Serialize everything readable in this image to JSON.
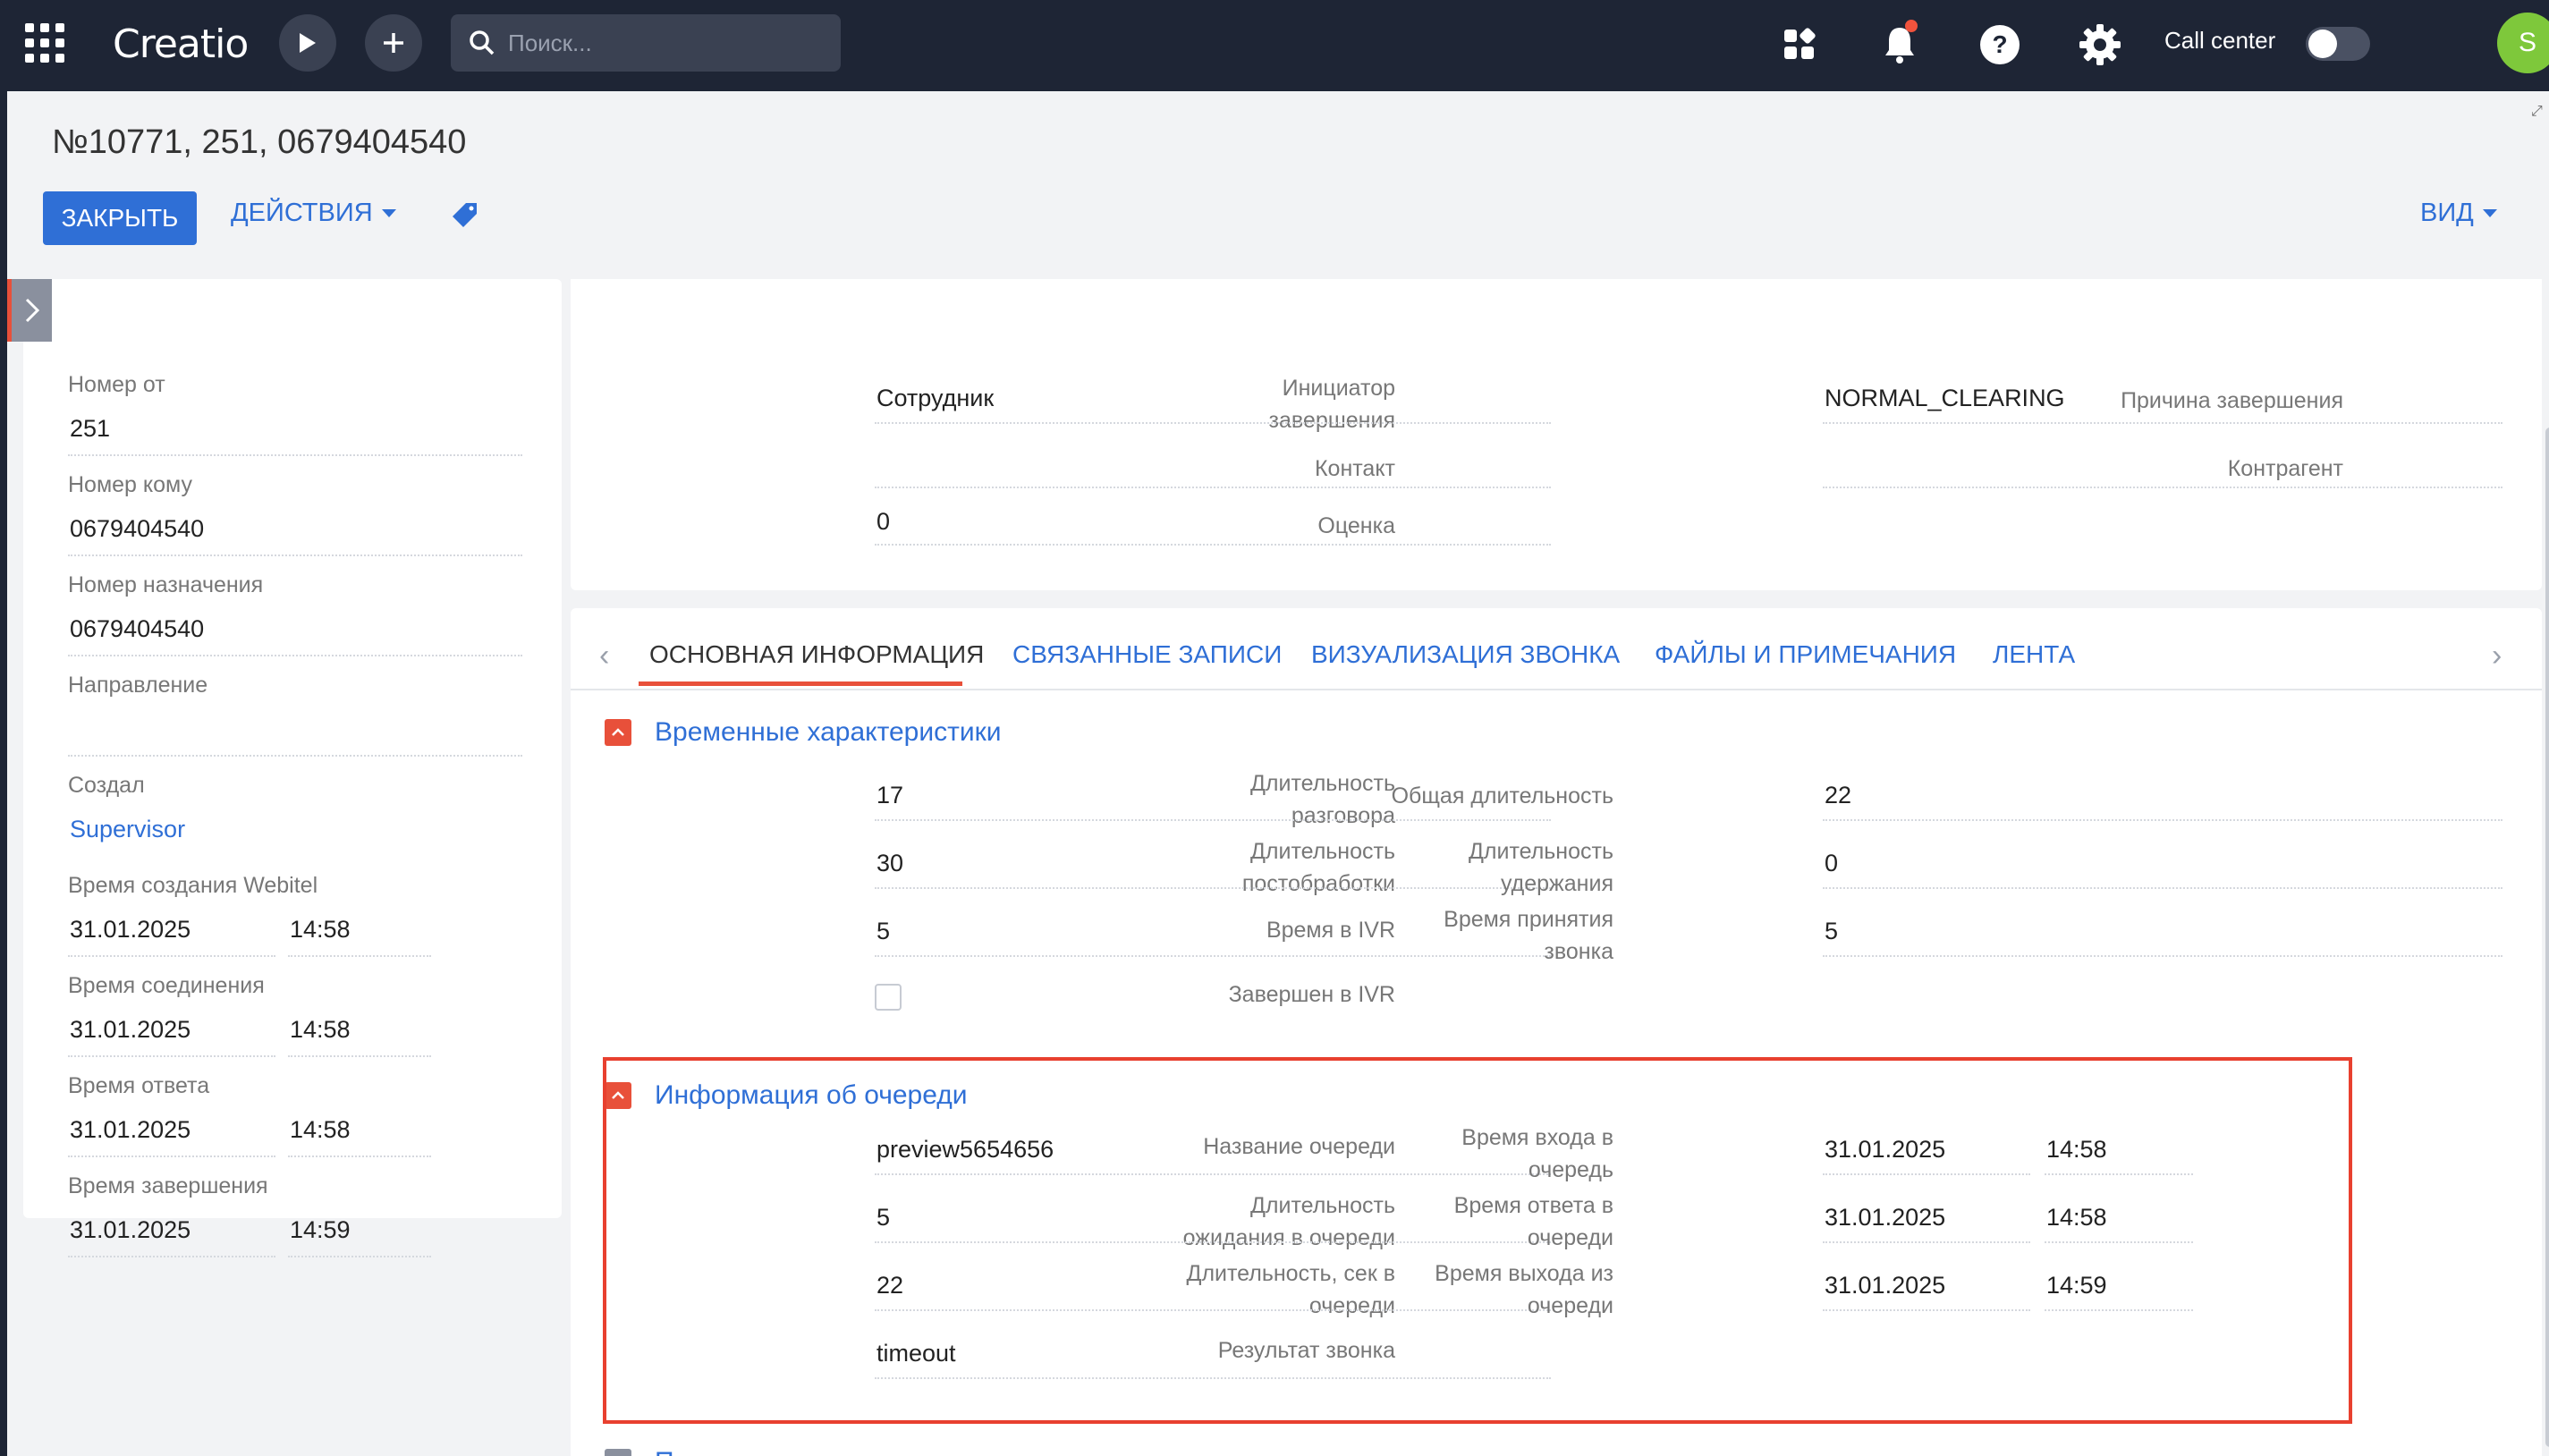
{
  "topbar": {
    "logo": "Creatio",
    "search_placeholder": "Поиск...",
    "call_center_label": "Call center",
    "avatar_initial": "S"
  },
  "record": {
    "title": "№10771, 251, 0679404540",
    "close_label": "ЗАКРЫТЬ",
    "actions_label": "ДЕЙСТВИЯ",
    "view_label": "ВИД"
  },
  "left_panel": {
    "number_from_label": "Номер от",
    "number_from": "251",
    "number_to_label": "Номер кому",
    "number_to": "0679404540",
    "dest_number_label": "Номер назначения",
    "dest_number": "0679404540",
    "direction_label": "Направление",
    "direction": "",
    "created_label": "Создал",
    "created_by": "Supervisor",
    "webitel_time_label": "Время создания Webitel",
    "webitel_date": "31.01.2025",
    "webitel_time": "14:58",
    "connect_time_label": "Время соединения",
    "connect_date": "31.01.2025",
    "connect_time": "14:58",
    "answer_time_label": "Время ответа",
    "answer_date": "31.01.2025",
    "answer_time": "14:58",
    "end_time_label": "Время завершения",
    "end_date": "31.01.2025",
    "end_time": "14:59"
  },
  "top_card": {
    "initiator_label_1": "Инициатор",
    "initiator_label_2": "завершения",
    "initiator": "Сотрудник",
    "reason_label": "Причина завершения",
    "reason": "NORMAL_CLEARING",
    "contact_label": "Контакт",
    "contact": "",
    "account_label": "Контрагент",
    "account": "",
    "rating_label": "Оценка",
    "rating": "0"
  },
  "tabs": [
    {
      "label": "ОСНОВНАЯ ИНФОРМАЦИЯ",
      "active": true
    },
    {
      "label": "СВЯЗАННЫЕ ЗАПИСИ",
      "active": false
    },
    {
      "label": "ВИЗУАЛИЗАЦИЯ ЗВОНКА",
      "active": false
    },
    {
      "label": "ФАЙЛЫ И ПРИМЕЧАНИЯ",
      "active": false
    },
    {
      "label": "ЛЕНТА",
      "active": false
    }
  ],
  "time_group": {
    "title": "Временные характеристики",
    "talk_label_1": "Длительность",
    "talk_label_2": "разговора",
    "talk": "17",
    "total_label": "Общая длительность",
    "total": "22",
    "post_label_1": "Длительность",
    "post_label_2": "постобработки",
    "post": "30",
    "hold_label_1": "Длительность",
    "hold_label_2": "удержания",
    "hold": "0",
    "ivr_label": "Время в IVR",
    "ivr": "5",
    "accept_label_1": "Время принятия",
    "accept_label_2": "звонка",
    "accept": "5",
    "ivr_done_label": "Завершен в IVR",
    "ivr_done": false
  },
  "queue_group": {
    "title": "Информация об очереди",
    "queue_name_label": "Название очереди",
    "queue_name": "preview5654656",
    "wait_label_1": "Длительность",
    "wait_label_2": "ожидания в очереди",
    "wait": "5",
    "dur_label_1": "Длительность, сек в",
    "dur_label_2": "очереди",
    "dur": "22",
    "result_label": "Результат звонка",
    "result": "timeout",
    "enter_label_1": "Время входа в",
    "enter_label_2": "очередь",
    "enter_date": "31.01.2025",
    "enter_time": "14:58",
    "answer_label_1": "Время ответа в",
    "answer_label_2": "очереди",
    "answer_date": "31.01.2025",
    "answer_time": "14:58",
    "exit_label_1": "Время выхода из",
    "exit_label_2": "очереди",
    "exit_date": "31.01.2025",
    "exit_time": "14:59"
  },
  "vars_group": {
    "title": "Переменные"
  },
  "colors": {
    "accent": "#2f6fd6",
    "topbar": "#1e2535",
    "highlight": "#e8402f",
    "group_open": "#e8503a"
  }
}
